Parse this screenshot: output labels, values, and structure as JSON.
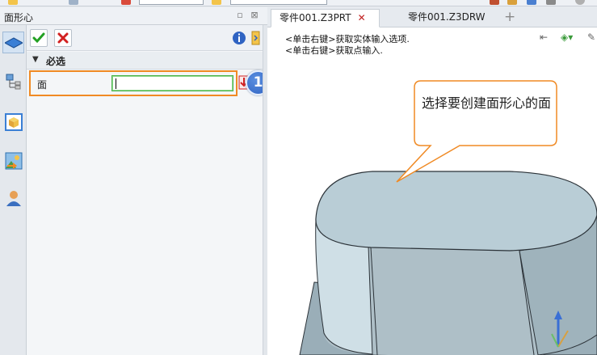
{
  "panel": {
    "title": "面形心",
    "section_label": "必选",
    "field_label": "面",
    "field_value": "",
    "step_number": "1"
  },
  "tabs": [
    {
      "label": "零件001.Z3PRT",
      "active": true
    },
    {
      "label": "零件001.Z3DRW",
      "active": false
    }
  ],
  "viewport": {
    "hint_line1": "<单击右键>获取实体输入选项.",
    "hint_line2": "<单击右键>获取点输入.",
    "callout": "选择要创建面形心的面"
  },
  "colors": {
    "highlight_border": "#f08a24",
    "input_border": "#4bb34b",
    "badge": "#2f63c2",
    "callout_border": "#f08a24",
    "part_face": "#b9cdd6"
  },
  "icons": {
    "ok": "check-icon",
    "cancel": "x-icon",
    "info": "info-icon",
    "pick": "pick-arrow-icon",
    "add_tab": "plus-icon"
  }
}
